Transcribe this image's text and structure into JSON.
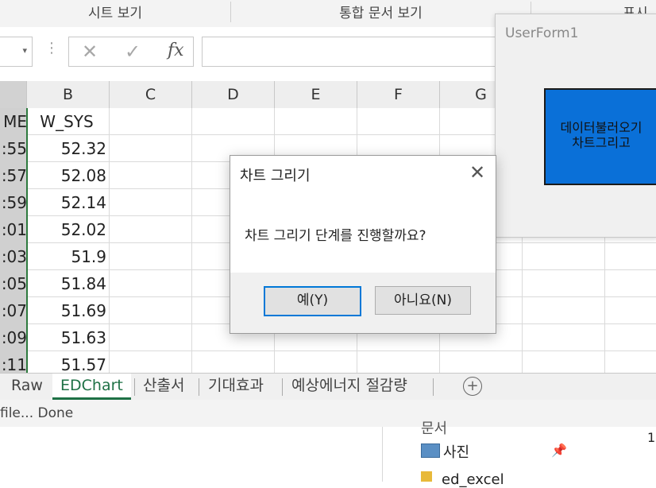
{
  "ribbon": {
    "group_sheet_view": "시트 보기",
    "group_workbook_view": "통합 문서 보기",
    "group_show_partial": "표시"
  },
  "formula_bar": {
    "cancel_icon": "✕",
    "enter_icon": "✓",
    "fx_label": "fx",
    "value": ""
  },
  "columns": [
    "B",
    "C",
    "D",
    "E",
    "F",
    "G"
  ],
  "rows": [
    {
      "a": "ME",
      "b": "W_SYS"
    },
    {
      "a": ":55",
      "b": "52.32"
    },
    {
      "a": ":57",
      "b": "52.08"
    },
    {
      "a": ":59",
      "b": "52.14"
    },
    {
      "a": ":01",
      "b": "52.02"
    },
    {
      "a": ":03",
      "b": "51.9"
    },
    {
      "a": ":05",
      "b": "51.84"
    },
    {
      "a": ":07",
      "b": "51.69"
    },
    {
      "a": ":09",
      "b": "51.63"
    },
    {
      "a": ":11",
      "b": "51.57"
    }
  ],
  "tabs": [
    {
      "label": "Raw",
      "active": false
    },
    {
      "label": "EDChart",
      "active": true
    },
    {
      "label": "산출서",
      "active": false
    },
    {
      "label": "기대효과",
      "active": false
    },
    {
      "label": "예상에너지 절감량",
      "active": false
    }
  ],
  "status_text": "file... Done",
  "explorer": {
    "item_top": "문서",
    "item_photos": "사진",
    "item_folder": "ed_excel",
    "right_num": "1"
  },
  "userform": {
    "title": "UserForm1",
    "button_line1": "데이터불러오기",
    "button_line2": "차트그리고"
  },
  "dialog": {
    "title": "차트 그리기",
    "message": "차트 그리기 단계를 진행할까요?",
    "yes_label": "예(Y)",
    "no_label": "아니요(N)"
  },
  "colors": {
    "accent_green": "#1e7145",
    "form_button_blue": "#0a70d8",
    "default_button_border": "#0078d7"
  }
}
